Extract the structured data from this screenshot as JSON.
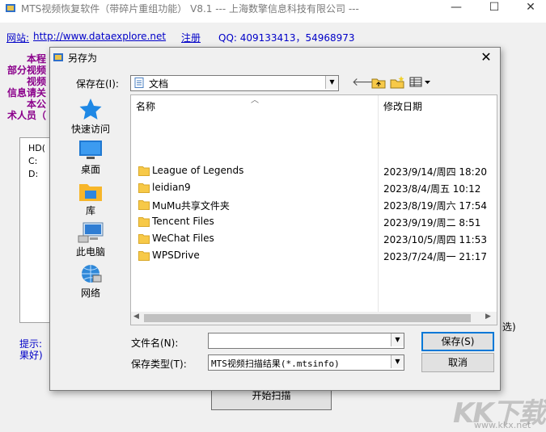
{
  "window": {
    "title": "MTS视频恢复软件（带碎片重组功能） V8.1 --- 上海数擎信息科技有限公司 ---",
    "minimize": "—",
    "maximize": "☐",
    "close": "✕"
  },
  "header": {
    "site_label": "网站:",
    "site_url": "http://www.dataexplore.net",
    "register": "注册",
    "qq": "QQ: 409133413，54968973"
  },
  "background_text": [
    "本程",
    "部分视频",
    "视频",
    "信息请关",
    "本公",
    "术人员（"
  ],
  "tree": {
    "items": [
      "HD(",
      "C:",
      "D:"
    ]
  },
  "hint": {
    "line1": "提示:",
    "line2": "果好)"
  },
  "select_suffix": "选)",
  "start_button": "开始扫描",
  "watermark": {
    "text": "KK下载",
    "url": "www.kkx.net"
  },
  "dialog": {
    "title": "另存为",
    "close": "✕",
    "save_in_label": "保存在(I):",
    "save_in_value": "文档",
    "places": [
      {
        "label": "快速访问",
        "icon": "star-icon"
      },
      {
        "label": "桌面",
        "icon": "desktop-icon"
      },
      {
        "label": "库",
        "icon": "library-icon"
      },
      {
        "label": "此电脑",
        "icon": "computer-icon"
      },
      {
        "label": "网络",
        "icon": "network-icon"
      }
    ],
    "columns": {
      "name": "名称",
      "date": "修改日期"
    },
    "files": [
      {
        "name": "League of Legends",
        "date": "2023/9/14/周四 18:20"
      },
      {
        "name": "leidian9",
        "date": "2023/8/4/周五 10:12"
      },
      {
        "name": "MuMu共享文件夹",
        "date": "2023/8/19/周六 17:54"
      },
      {
        "name": "Tencent Files",
        "date": "2023/9/19/周二 8:51"
      },
      {
        "name": "WeChat Files",
        "date": "2023/10/5/周四 11:53"
      },
      {
        "name": "WPSDrive",
        "date": "2023/7/24/周一 21:17"
      }
    ],
    "filename_label": "文件名(N):",
    "filename_value": "",
    "filetype_label": "保存类型(T):",
    "filetype_value": "MTS视频扫描结果(*.mtsinfo)",
    "save_button": "保存(S)",
    "cancel_button": "取消"
  },
  "colors": {
    "folder": "#f7c948",
    "link": "#0000c8",
    "purple": "#8b008b"
  }
}
